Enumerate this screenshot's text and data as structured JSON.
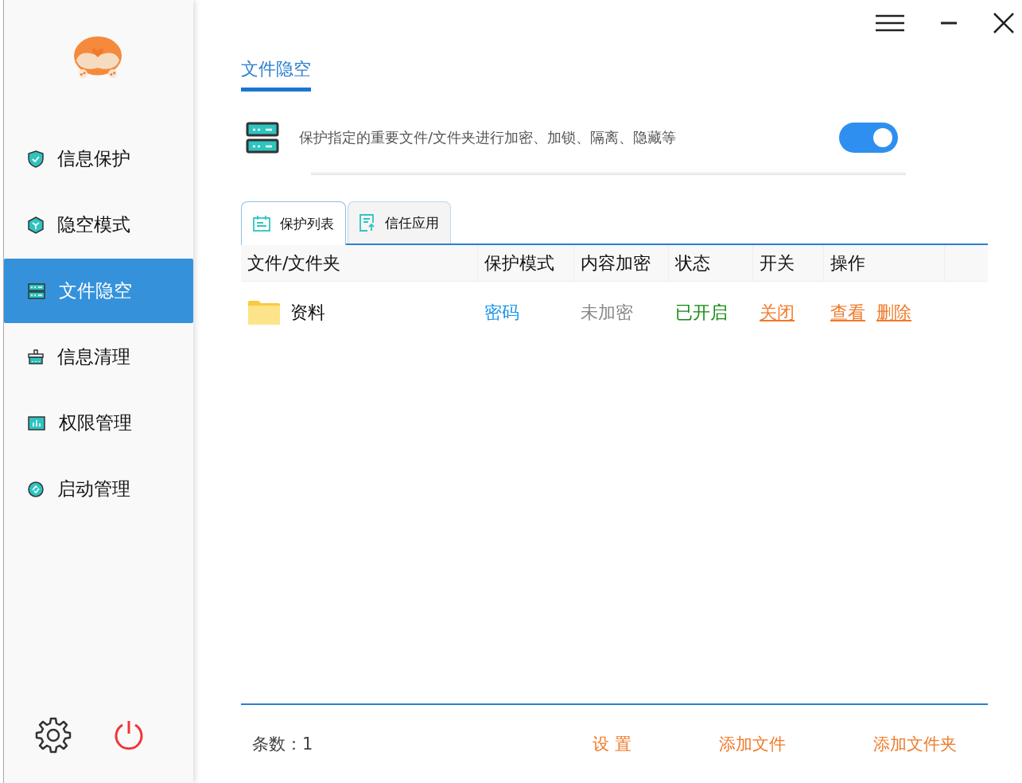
{
  "sidebar": {
    "items": [
      {
        "label": "信息保护",
        "kind": "shield",
        "selected": false
      },
      {
        "label": "隐空模式",
        "kind": "cube",
        "selected": false
      },
      {
        "label": "文件隐空",
        "kind": "server",
        "selected": true
      },
      {
        "label": "信息清理",
        "kind": "broom",
        "selected": false
      },
      {
        "label": "权限管理",
        "kind": "chart",
        "selected": false
      },
      {
        "label": "启动管理",
        "kind": "cycle",
        "selected": false
      }
    ]
  },
  "page_tab": {
    "label": "文件隐空",
    "selected": true
  },
  "feature": {
    "description": "保护指定的重要文件/文件夹进行加密、加锁、隔离、隐藏等",
    "on": true
  },
  "tabs": [
    {
      "label": "保护列表",
      "kind": "calendar",
      "selected": true
    },
    {
      "label": "信任应用",
      "kind": "doc",
      "selected": false
    }
  ],
  "table": {
    "columns": [
      "文件/文件夹",
      "保护模式",
      "内容加密",
      "状态",
      "开关",
      "操作"
    ],
    "rows": [
      {
        "name": "资料",
        "mode": "密码",
        "encryption": "未加密",
        "status": "已开启",
        "switch": "关闭",
        "actions": [
          "查看",
          "删除"
        ]
      }
    ]
  },
  "footer": {
    "count": "条数：1",
    "buttons": [
      "设 置",
      "添加文件",
      "添加文件夹"
    ]
  }
}
